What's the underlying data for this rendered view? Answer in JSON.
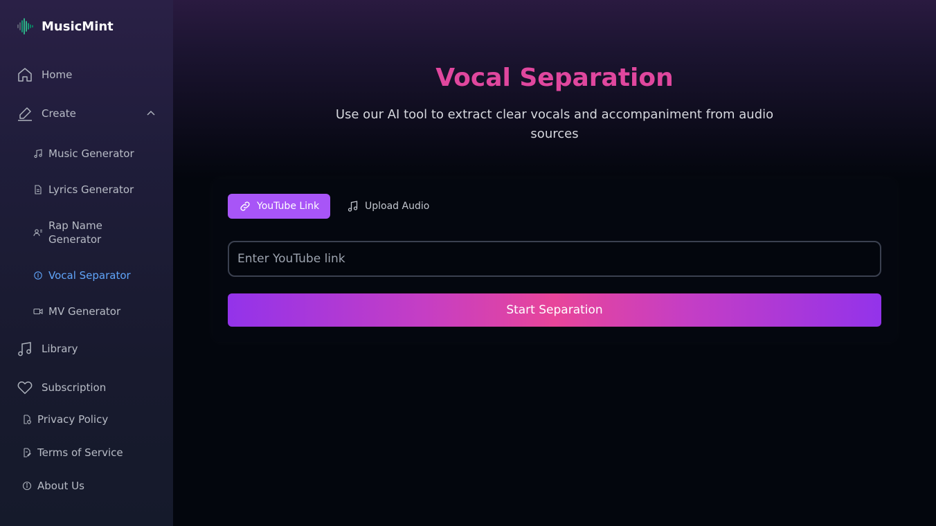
{
  "app": {
    "name": "MusicMint"
  },
  "sidebar": {
    "home": "Home",
    "create": "Create",
    "create_items": [
      {
        "label": "Music Generator",
        "icon": "music-note-icon"
      },
      {
        "label": "Lyrics Generator",
        "icon": "document-icon"
      },
      {
        "label": "Rap Name Generator",
        "icon": "user-list-icon"
      },
      {
        "label": "Vocal Separator",
        "icon": "separator-icon",
        "active": true
      },
      {
        "label": "MV Generator",
        "icon": "video-camera-icon"
      }
    ],
    "library": "Library",
    "subscription": "Subscription",
    "privacy": "Privacy Policy",
    "terms": "Terms of Service",
    "about": "About Us"
  },
  "main": {
    "title": "Vocal Separation",
    "subtitle": "Use our AI tool to extract clear vocals and accompaniment from audio sources",
    "tabs": [
      {
        "label": "YouTube Link",
        "icon": "link-icon",
        "active": true
      },
      {
        "label": "Upload Audio",
        "icon": "music-note-icon",
        "active": false
      }
    ],
    "input": {
      "placeholder": "Enter YouTube link",
      "value": ""
    },
    "start_button": "Start Separation"
  },
  "colors": {
    "accent_purple": "#a855f7",
    "title_pink": "#e0479e",
    "active_link": "#60a5fa",
    "logo_green": "#34d399"
  }
}
